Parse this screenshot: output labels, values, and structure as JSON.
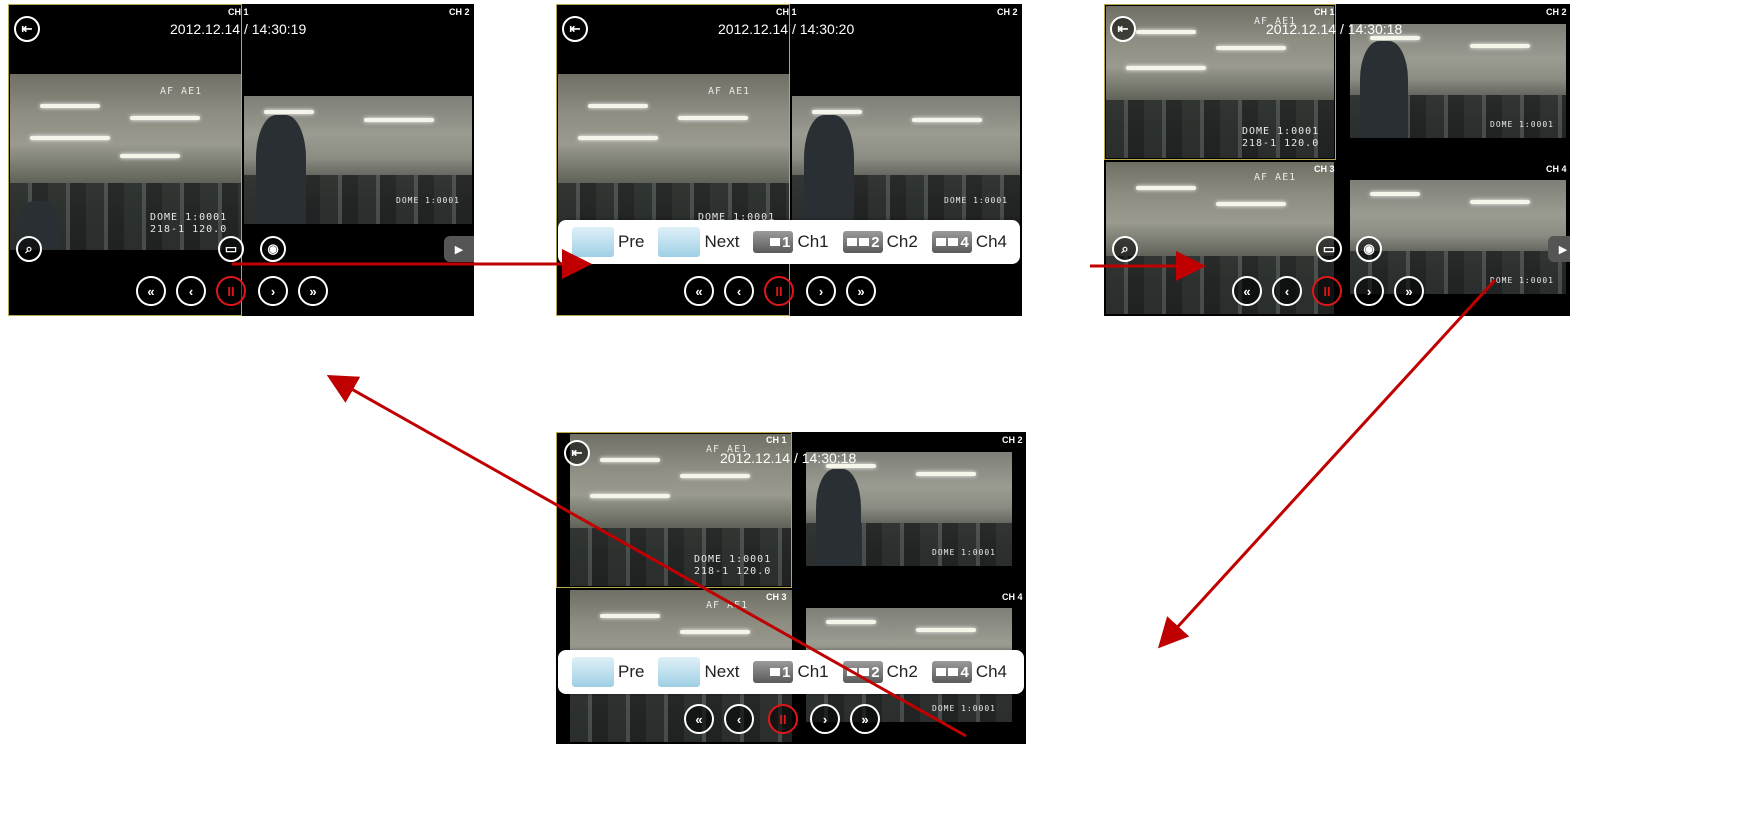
{
  "screens": [
    {
      "id": "s1",
      "date": "2012.12.14 / 14:30:19",
      "channels": [
        "CH 1",
        "CH 2"
      ],
      "osd_top": "AF AE1",
      "osd_bottom_1": "DOME 1:0001",
      "osd_bottom_2": "218-1 120.0",
      "osd_right": "DOME 1:0001"
    },
    {
      "id": "s2",
      "date": "2012.12.14 / 14:30:20",
      "channels": [
        "CH 1",
        "CH 2"
      ],
      "osd_top": "AF AE1",
      "osd_bottom_1": "DOME 1:0001",
      "osd_right": "DOME 1:0001"
    },
    {
      "id": "s3",
      "date": "2012.12.14 / 14:30:18",
      "channels": [
        "CH 1",
        "CH 2",
        "CH 3",
        "CH 4"
      ],
      "osd_top": "AF AE1",
      "osd_bottom_1": "DOME 1:0001",
      "osd_bottom_2": "218-1 120.0",
      "osd_right": "DOME 1:0001"
    },
    {
      "id": "s4",
      "date": "2012.12.14 / 14:30:18",
      "channels": [
        "CH 1",
        "CH 2",
        "CH 3",
        "CH 4"
      ],
      "osd_top": "AF AE1",
      "osd_bottom_1": "DOME 1:0001",
      "osd_bottom_2": "218-1 120.0",
      "osd_right": "DOME 1:0001"
    }
  ],
  "toolbar": {
    "pre_label": "Pre",
    "next_label": "Next",
    "ch1_label": "Ch1",
    "ch1_num": "1",
    "ch2_label": "Ch2",
    "ch2_num": "2",
    "ch4_label": "Ch4",
    "ch4_num": "4"
  },
  "controls": {
    "fast_rewind": "«",
    "prev": "‹",
    "pause": "II",
    "next": "›",
    "fast_forward": "»",
    "side_tab": "▶"
  },
  "icons": [
    "exit-icon",
    "zoom-icon",
    "layout-icon",
    "camera-icon"
  ],
  "colors": {
    "accent_red": "#e0161a",
    "arrow_red": "#c00000",
    "frame_yellow": "#b9a84a"
  }
}
